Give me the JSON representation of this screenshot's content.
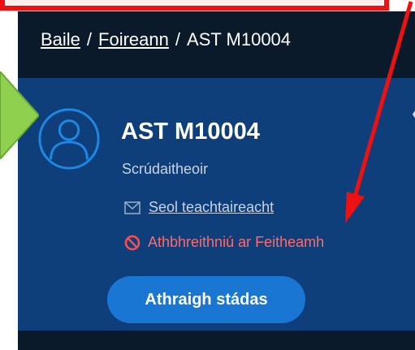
{
  "breadcrumb": {
    "home": "Baile",
    "separator": "/",
    "team": "Foireann",
    "current": "AST M10004"
  },
  "profile": {
    "name": "AST M10004",
    "role": "Scrúdaitheoir",
    "send_message": "Seol teachtaireacht",
    "status": "Athbhreithniú ar Feitheamh",
    "change_status_button": "Athraigh stádas"
  },
  "icons": {
    "avatar": "user-avatar-icon",
    "message": "envelope-icon",
    "status": "blocked-icon",
    "collapse": "chevron-double-left-icon"
  },
  "colors": {
    "header_bg": "#0b1a2b",
    "panel_bg": "#0f3f7a",
    "button_bg": "#1976d2",
    "status_text": "#ff6b6b",
    "annotation_red": "#ee1111",
    "annotation_green": "#8fd14f"
  }
}
